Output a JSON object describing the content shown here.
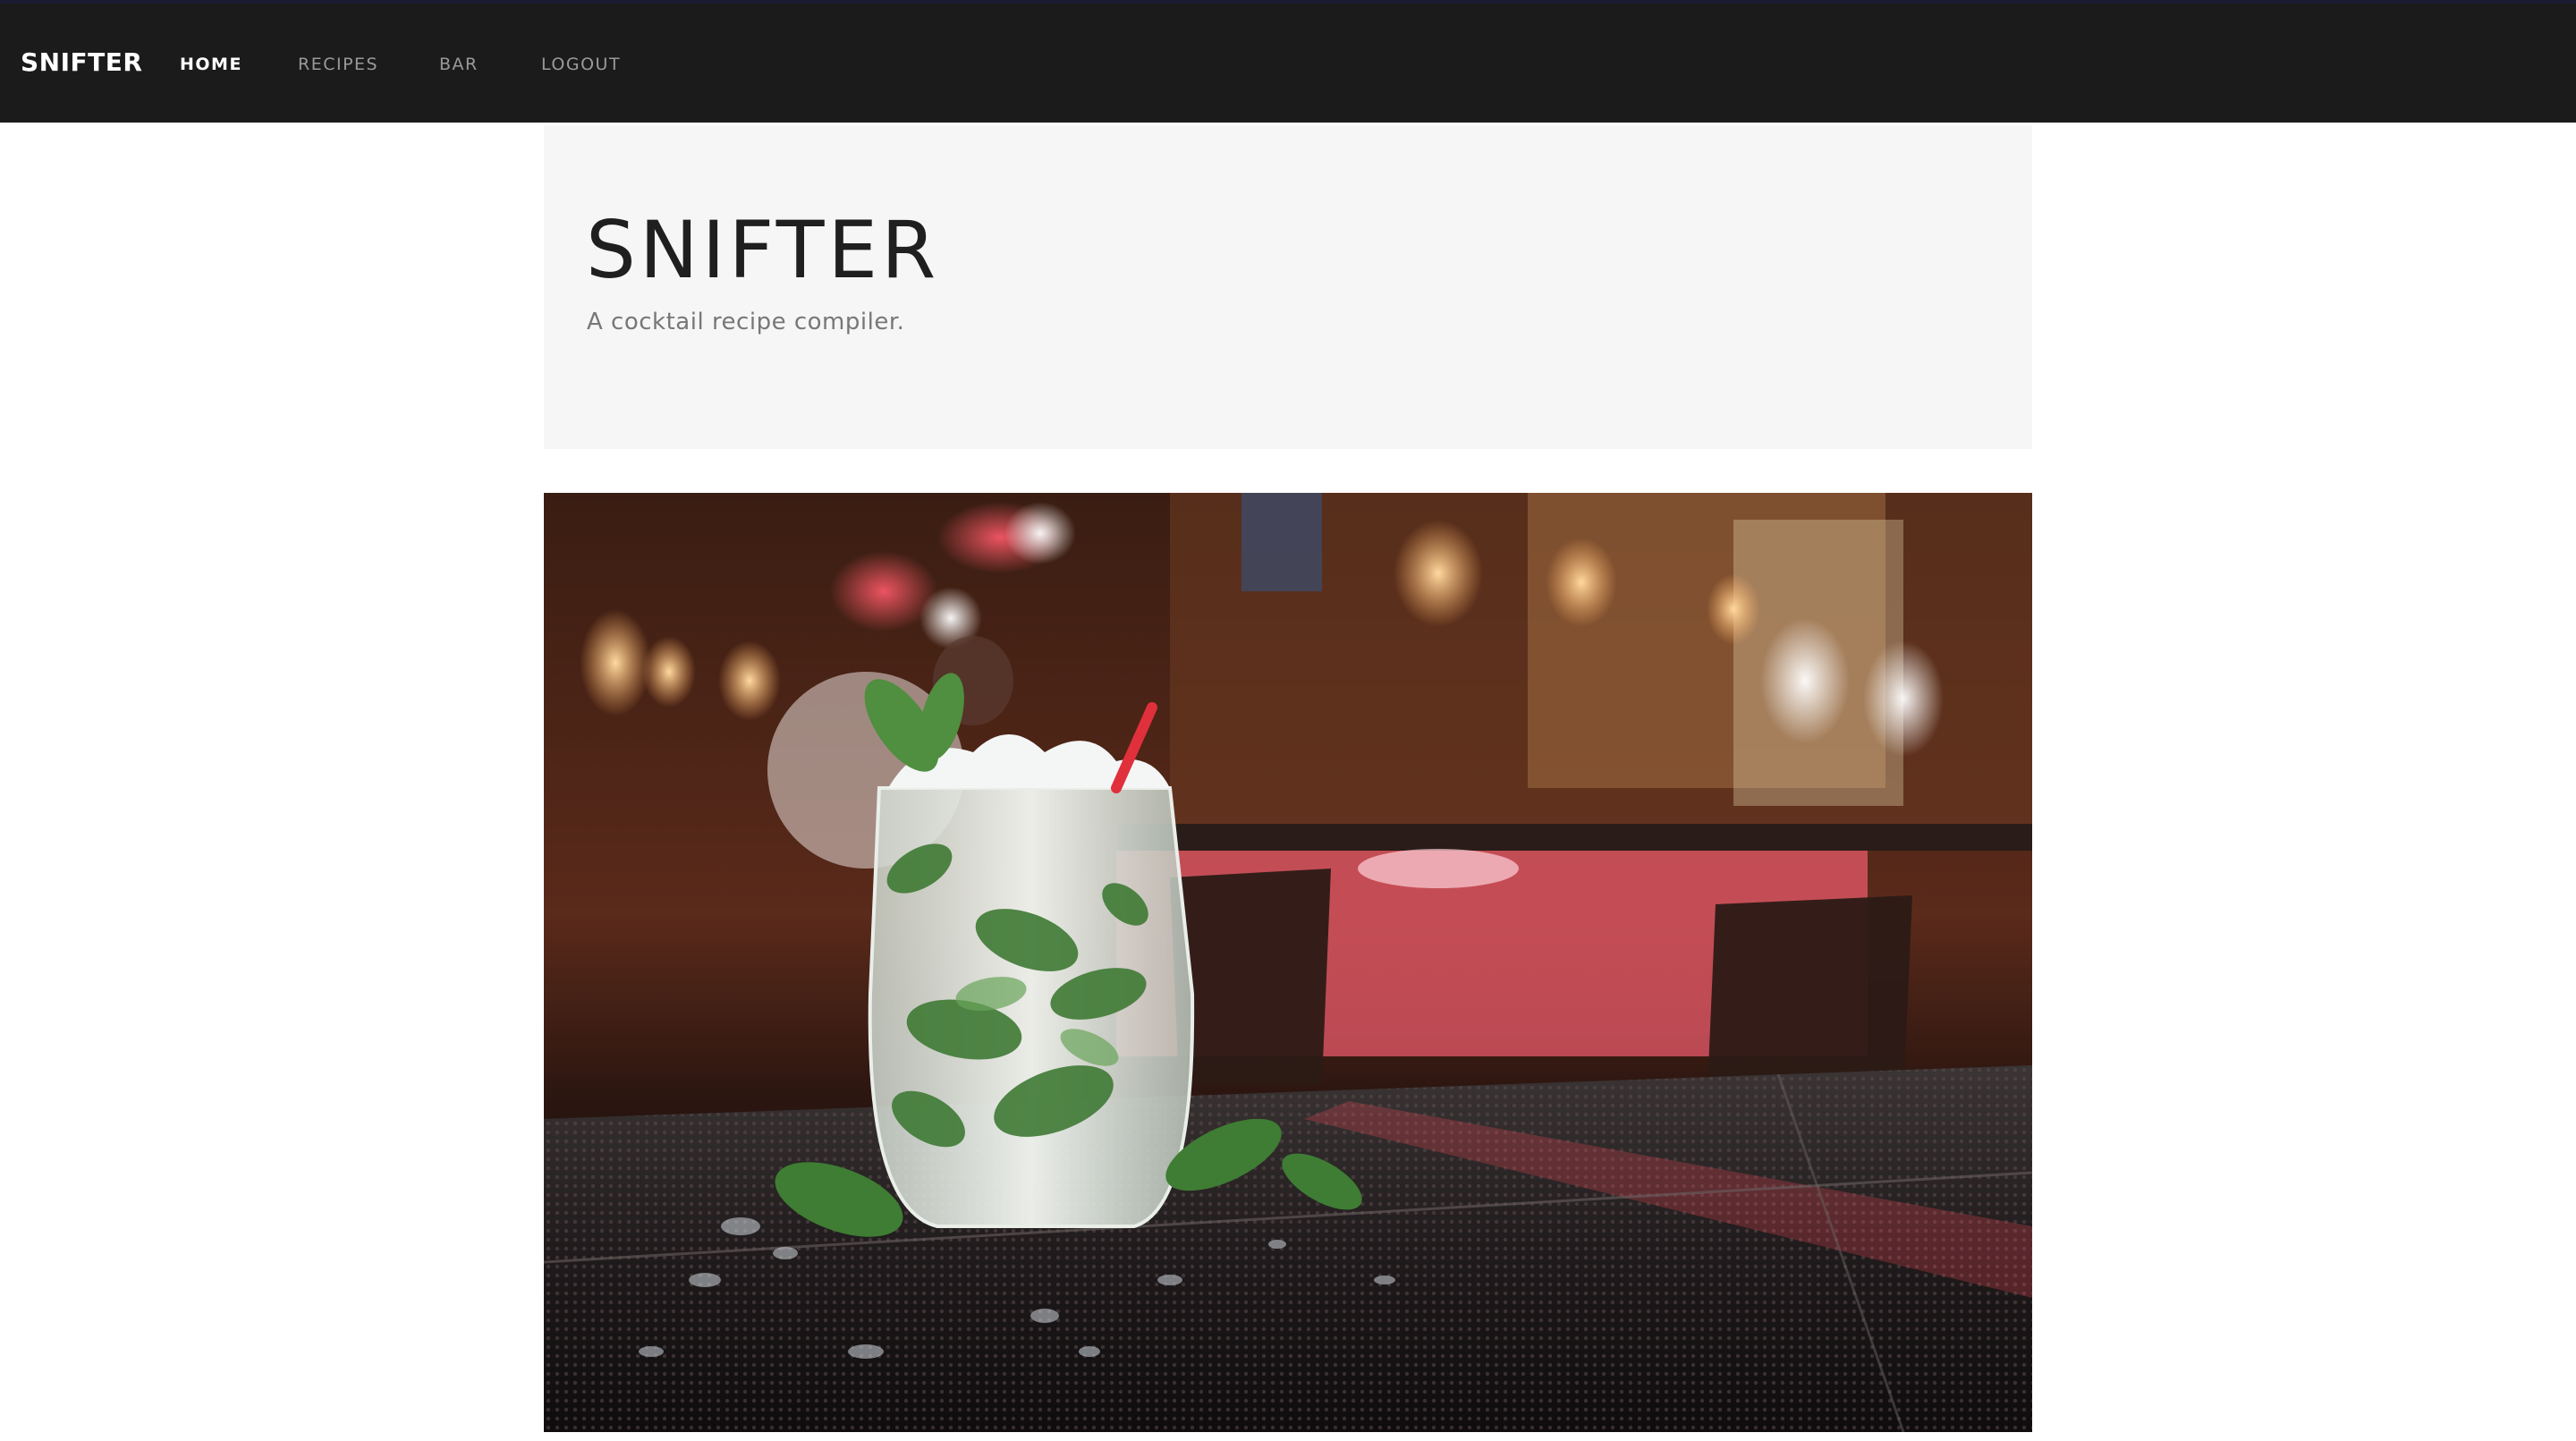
{
  "navbar": {
    "brand": "SNIFTER",
    "links": [
      {
        "label": "HOME",
        "active": true
      },
      {
        "label": "RECIPES",
        "active": false
      },
      {
        "label": "BAR",
        "active": false
      },
      {
        "label": "LOGOUT",
        "active": false
      }
    ]
  },
  "jumbotron": {
    "title": "SNIFTER",
    "subtitle": "A cocktail recipe compiler."
  },
  "hero": {
    "alt": "mojito cocktail on a bar counter"
  },
  "colors": {
    "navbar_bg": "#1b1b1b",
    "jumbotron_bg": "#f6f6f7",
    "text_muted": "#777777",
    "text_dark": "#1f1f1f"
  }
}
